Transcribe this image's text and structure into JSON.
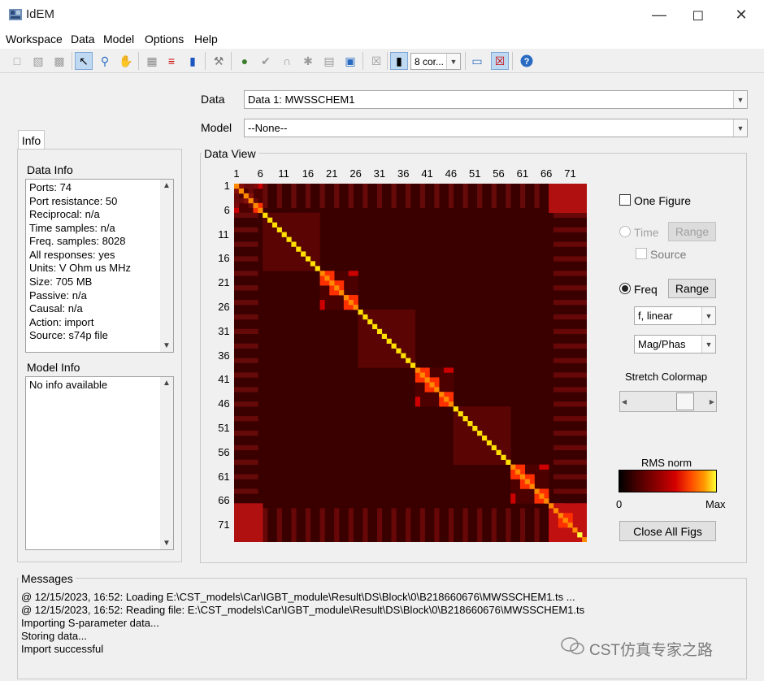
{
  "window": {
    "title": "IdEM"
  },
  "menu": [
    "Workspace",
    "Data",
    "Model",
    "Options",
    "Help"
  ],
  "toolbar": {
    "icons": [
      "new-file-icon",
      "open-file-icon",
      "save-icon",
      "pointer-icon",
      "zoom-icon",
      "pan-hand-icon",
      "import-icon",
      "split-icon",
      "merge-icon",
      "tools-icon",
      "fit-icon",
      "check-icon",
      "passive-icon",
      "enforce-icon",
      "report-icon",
      "export-icon",
      "close-icon",
      "cores-icon",
      "window-icon",
      "close-figures-icon",
      "help-icon"
    ],
    "cores_label": "8 cor..."
  },
  "selectors": {
    "data_label": "Data",
    "data_value": "Data 1: MWSSCHEM1",
    "model_label": "Model",
    "model_value": "--None--"
  },
  "info_tab": "Info",
  "data_info": {
    "title": "Data Info",
    "lines": [
      "Ports: 74",
      "Port resistance: 50",
      "Reciprocal: n/a",
      "Time samples: n/a",
      "Freq. samples: 8028",
      "All responses: yes",
      "Units: V Ohm us MHz",
      "Size: 705 MB",
      "Passive: n/a",
      "Causal: n/a",
      "Action: import",
      "Source: s74p file"
    ]
  },
  "model_info": {
    "title": "Model Info",
    "text": "No info available"
  },
  "data_view": {
    "title": "Data View",
    "x_ticks": [
      "1",
      "6",
      "11",
      "16",
      "21",
      "26",
      "31",
      "36",
      "41",
      "46",
      "51",
      "56",
      "61",
      "66",
      "71"
    ],
    "y_ticks": [
      "1",
      "6",
      "11",
      "16",
      "21",
      "26",
      "31",
      "36",
      "41",
      "46",
      "51",
      "56",
      "61",
      "66",
      "71"
    ],
    "ports": 74
  },
  "controls": {
    "one_figure": "One Figure",
    "time": "Time",
    "time_range": "Range",
    "source": "Source",
    "freq": "Freq",
    "freq_range": "Range",
    "freq_axis": "f, linear",
    "display": "Mag/Phas",
    "stretch": "Stretch Colormap",
    "slider_level": 0.78,
    "colorbar_title": "RMS norm",
    "colorbar_min": "0",
    "colorbar_max": "Max",
    "close_all": "Close All Figs"
  },
  "colors": {
    "heat_dark": "#3a0000",
    "heat_mid": "#cc0000",
    "heat_hot": "#ff3000",
    "heat_max": "#ffe000"
  },
  "messages": {
    "title": "Messages",
    "lines": [
      "@ 12/15/2023, 16:52: Loading E:\\CST_models\\Car\\IGBT_module\\Result\\DS\\Block\\0\\B218660676\\MWSSCHEM1.ts ...",
      "@ 12/15/2023, 16:52: Reading file: E:\\CST_models\\Car\\IGBT_module\\Result\\DS\\Block\\0\\B218660676\\MWSSCHEM1.ts",
      "Importing S-parameter data...",
      "Storing data...",
      "Import successful"
    ]
  },
  "watermark": "CST仿真专家之路"
}
